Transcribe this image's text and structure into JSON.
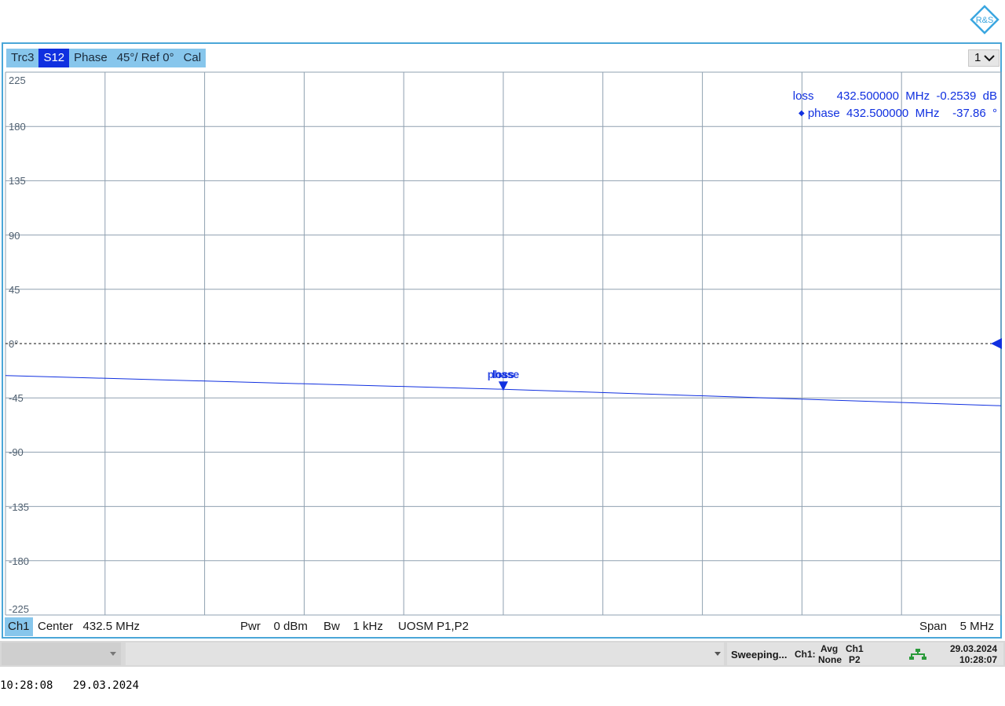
{
  "brand": {
    "logo_text": "R&S"
  },
  "trace": {
    "name": "Trc3",
    "param": "S12",
    "format": "Phase",
    "scale": "45°/ Ref 0°",
    "cal": "Cal",
    "window": "1"
  },
  "markers": [
    {
      "name": "loss",
      "active": false,
      "freq": "432.500000  MHz",
      "value": "-0.2539  dB"
    },
    {
      "name": "phase",
      "active": true,
      "freq": "432.500000  MHz",
      "value": "-37.86  °"
    }
  ],
  "marker_tag": {
    "text1": "loss",
    "text2": "phase"
  },
  "channel": {
    "label": "Ch1",
    "center": "Center   432.5 MHz",
    "pwr": "Pwr    0 dBm",
    "bw": "Bw    1 kHz",
    "cal": "UOSM P1,P2",
    "span": "Span    5 MHz"
  },
  "statusbar": {
    "state": "Sweeping...",
    "ch_label": "Ch1:",
    "avg_label": "Avg",
    "avg_value": "None",
    "ch_label2": "Ch1",
    "port": "P2",
    "date": "29.03.2024",
    "time": "10:28:07"
  },
  "timestamp": "10:28:08   29.03.2024",
  "colors": {
    "trace": "#1030e0",
    "grid": "#8fa0b0",
    "accent": "#4aa6d8"
  },
  "chart_data": {
    "type": "line",
    "title": "",
    "xlabel": "",
    "ylabel": "",
    "x_unit": "MHz",
    "xlim": [
      430.0,
      435.0
    ],
    "ylim": [
      -225,
      225
    ],
    "y_ticks": [
      "225",
      "180",
      "135",
      "90",
      "45",
      "0°",
      "-45",
      "-90",
      "-135",
      "-180",
      "-225"
    ],
    "y_tick_values": [
      225,
      180,
      135,
      90,
      45,
      0,
      -45,
      -90,
      -135,
      -180,
      -225
    ],
    "ref_value": 0,
    "grid": true,
    "series": [
      {
        "x": [
          430.0,
          432.5,
          435.0
        ],
        "y": [
          -26.5,
          -37.86,
          -51.5
        ]
      }
    ],
    "marker": {
      "x": 432.5,
      "y": -37.86
    }
  }
}
